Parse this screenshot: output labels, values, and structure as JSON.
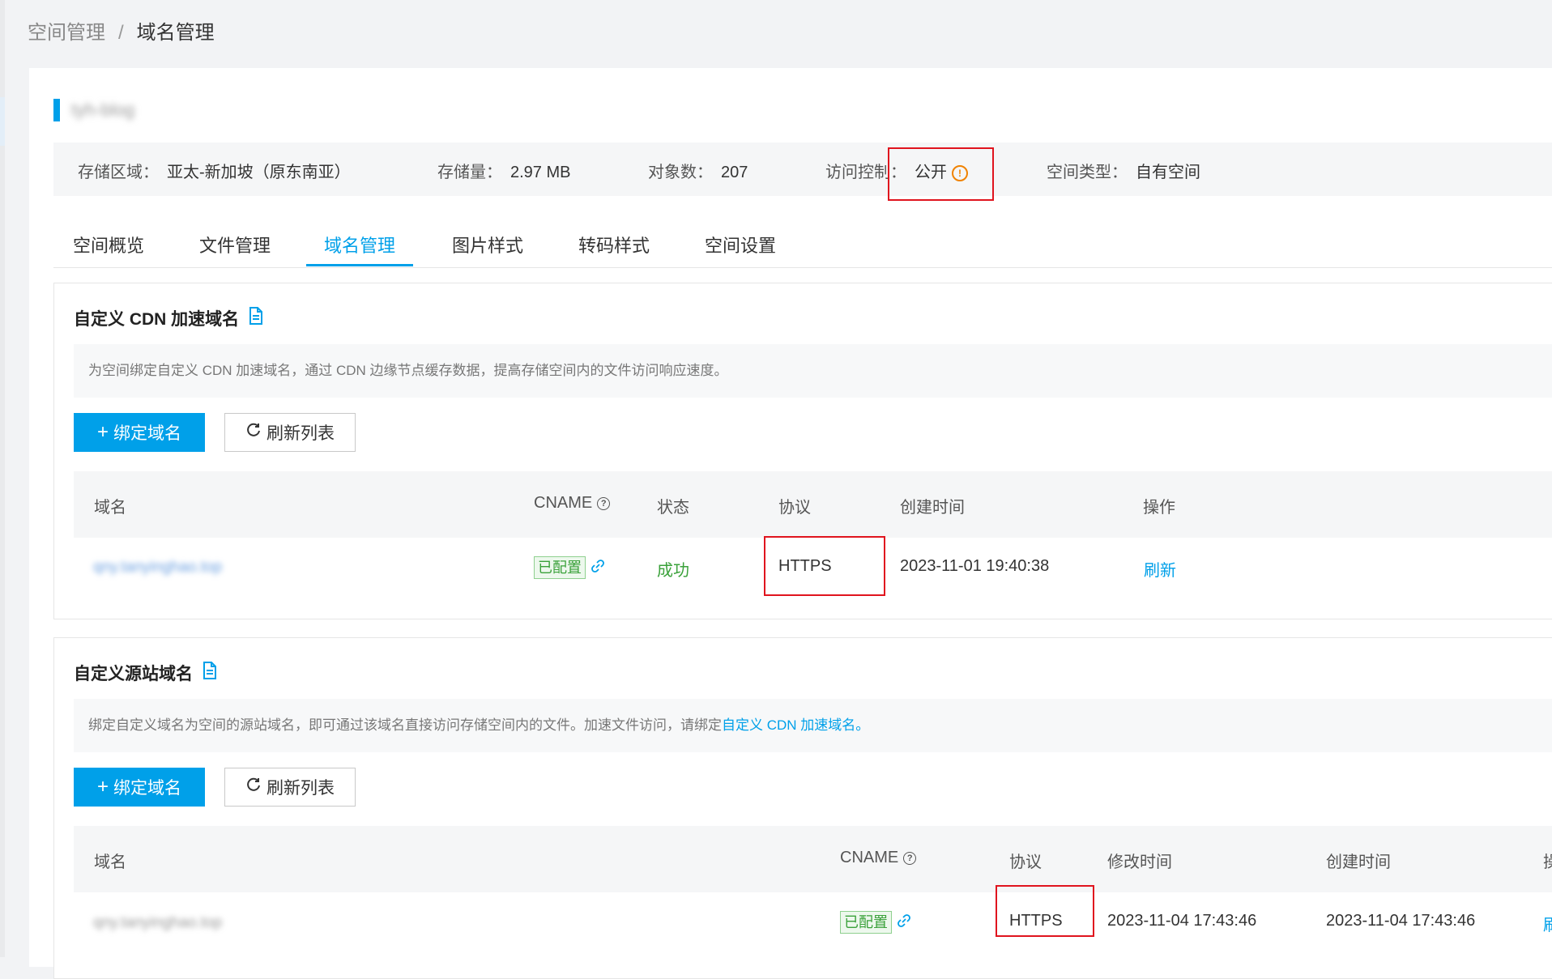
{
  "breadcrumb": {
    "root": "空间管理",
    "separator": "/",
    "current": "域名管理"
  },
  "bucket": {
    "name": "tyh-blog",
    "region_label": "存储区域：",
    "region": "亚太-新加坡（原东南亚）",
    "storage_label": "存储量：",
    "storage": "2.97 MB",
    "objects_label": "对象数：",
    "objects": "207",
    "acl_label": "访问控制：",
    "acl": "公开",
    "type_label": "空间类型：",
    "type": "自有空间"
  },
  "tabs": [
    "空间概览",
    "文件管理",
    "域名管理",
    "图片样式",
    "转码样式",
    "空间设置"
  ],
  "cdn": {
    "title": "自定义 CDN 加速域名",
    "description": "为空间绑定自定义 CDN 加速域名，通过 CDN 边缘节点缓存数据，提高存储空间内的文件访问响应速度。",
    "bind_button": "绑定域名",
    "refresh_button": "刷新列表",
    "columns": {
      "domain": "域名",
      "cname": "CNAME",
      "status": "状态",
      "protocol": "协议",
      "created": "创建时间",
      "ops": "操作"
    },
    "row": {
      "domain": "qny.tanyinghao.top",
      "cname": "已配置",
      "status": "成功",
      "protocol": "HTTPS",
      "created": "2023-11-01 19:40:38",
      "op": "刷新"
    }
  },
  "origin": {
    "title": "自定义源站域名",
    "description": "绑定自定义域名为空间的源站域名，即可通过该域名直接访问存储空间内的文件。加速文件访问，请绑定",
    "description_link": "自定义 CDN 加速域名。",
    "bind_button": "绑定域名",
    "refresh_button": "刷新列表",
    "columns": {
      "domain": "域名",
      "cname": "CNAME",
      "protocol": "协议",
      "modified": "修改时间",
      "created": "创建时间",
      "ops": "操"
    },
    "row": {
      "domain": "qny.tanyinghao.top",
      "cname": "已配置",
      "protocol": "HTTPS",
      "modified": "2023-11-04 17:43:46",
      "created": "2023-11-04 17:43:46",
      "op": "刷"
    }
  },
  "colors": {
    "accent": "#00a0e9",
    "warning": "#f08200",
    "success": "#3aa13a",
    "highlight_box": "#e0141e"
  }
}
